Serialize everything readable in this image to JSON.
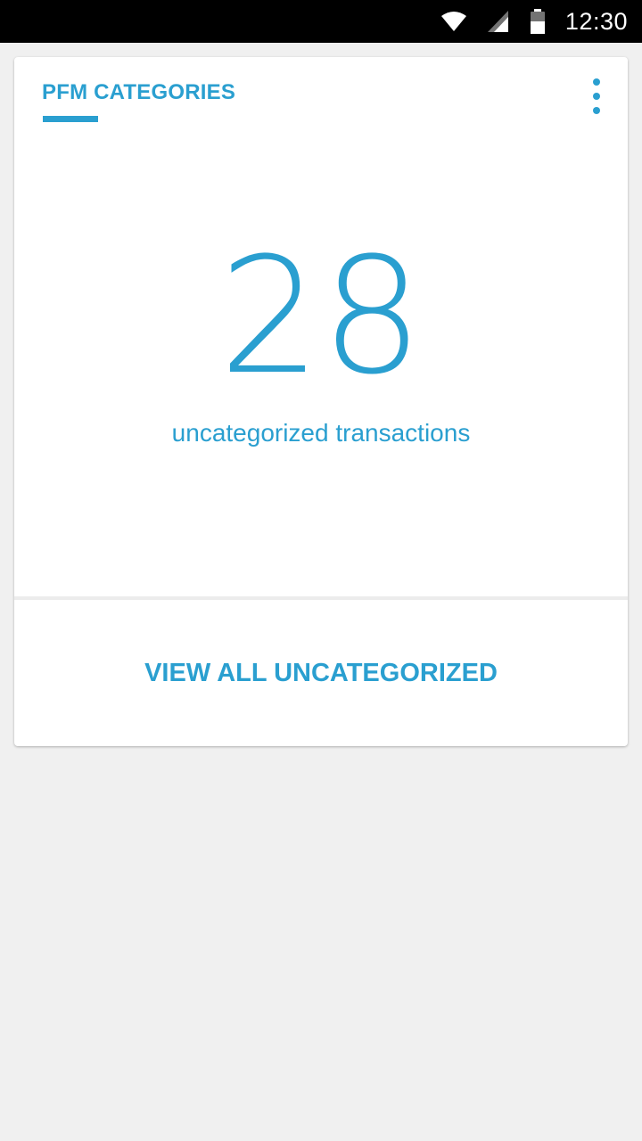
{
  "status_bar": {
    "time": "12:30",
    "icons": [
      "wifi-icon",
      "cell-signal-icon",
      "battery-icon"
    ]
  },
  "card": {
    "title": "PFM CATEGORIES",
    "menu_icon": "more-vertical-icon",
    "count": "28",
    "count_label": "uncategorized transactions",
    "action_label": "VIEW ALL UNCATEGORIZED"
  },
  "colors": {
    "accent": "#2a9fd0",
    "background": "#f0f0f0",
    "card": "#ffffff",
    "status_bar": "#000000"
  }
}
